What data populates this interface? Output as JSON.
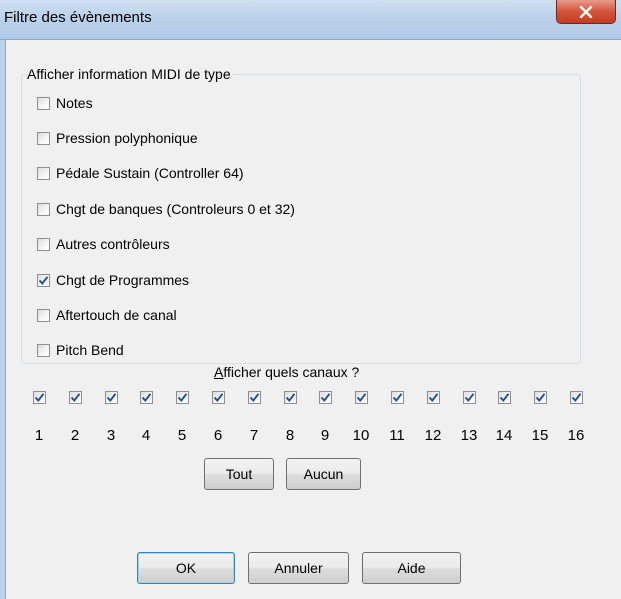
{
  "window": {
    "title": "Filtre des évènements",
    "close_glyph": "X"
  },
  "group": {
    "legend": "Afficher information MIDI de type",
    "items": [
      {
        "label": "Notes",
        "checked": false
      },
      {
        "label": "Pression polyphonique",
        "checked": false
      },
      {
        "label": "Pédale Sustain (Controller 64)",
        "checked": false
      },
      {
        "label": "Chgt de banques (Controleurs 0 et 32)",
        "checked": false
      },
      {
        "label": "Autres contrôleurs",
        "checked": false
      },
      {
        "label": "Chgt de Programmes",
        "checked": true
      },
      {
        "label": "Aftertouch de canal",
        "checked": false
      },
      {
        "label": "Pitch Bend",
        "checked": false
      }
    ]
  },
  "channels": {
    "title_accel": "A",
    "title_rest": "fficher quels canaux ?",
    "numbers": [
      "1",
      "2",
      "3",
      "4",
      "5",
      "6",
      "7",
      "8",
      "9",
      "10",
      "11",
      "12",
      "13",
      "14",
      "15",
      "16"
    ],
    "checked": [
      true,
      true,
      true,
      true,
      true,
      true,
      true,
      true,
      true,
      true,
      true,
      true,
      true,
      true,
      true,
      true
    ]
  },
  "buttons": {
    "all": "Tout",
    "none": "Aucun",
    "ok": "OK",
    "cancel": "Annuler",
    "help": "Aide"
  },
  "colors": {
    "check": "#1f4f9c",
    "close_bg": "#c94a30"
  }
}
